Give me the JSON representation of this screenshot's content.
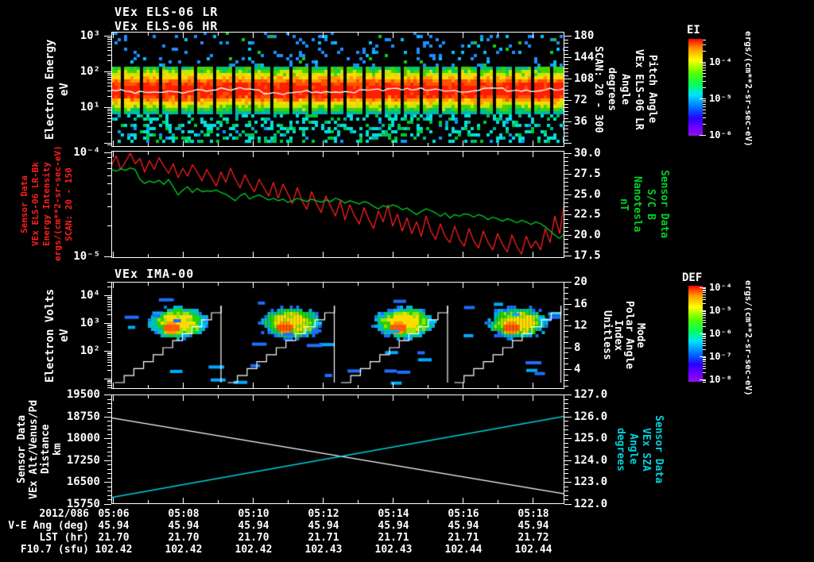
{
  "app": {
    "background": "#000000"
  },
  "colors": {
    "foreground": "#ffffff",
    "accent_red": "#ff1e1e",
    "accent_green": "#00d228",
    "accent_cyan": "#00d2dc",
    "rainbow_scale": [
      "#ff0000",
      "#ff9600",
      "#ffff00",
      "#50ff00",
      "#00e1ff",
      "#0064ff",
      "#7d00ff"
    ]
  },
  "titles": {
    "els_lr": "VEx ELS-06 LR",
    "els_hr": "VEx ELS-06 HR",
    "ima": "VEx IMA-00"
  },
  "time_axis": {
    "date": "2012/086",
    "tick_labels": [
      "05:06",
      "05:08",
      "05:10",
      "05:12",
      "05:14",
      "05:16",
      "05:18"
    ]
  },
  "chart_data": [
    {
      "name": "els_pitch_angle_spectrogram",
      "type": "heatmap",
      "title": "VEx ELS-06 LR / VEx ELS-06 HR",
      "left_axis": {
        "label_lines": [
          "Electron Energy",
          "eV"
        ],
        "scale": "log",
        "tick_labels": [
          "10³",
          "10²",
          "10¹"
        ]
      },
      "right_axis": {
        "label_lines": [
          "Pitch Angle",
          "VEx ELS-06 LR",
          "Angle",
          "degrees",
          "SCAN: 20 - 300"
        ],
        "tick_labels": [
          "180",
          "144",
          "108",
          "72",
          "36"
        ],
        "range": [
          0,
          180
        ]
      },
      "features": {
        "intense_band_energy_ev": [
          8,
          120
        ],
        "band_structure": "red-orange core with yellow then green edges",
        "overlay_line": "white pitch-angle trace wiggling near 72-90 deg",
        "data_gaps": "periodic narrow vertical black gaps through the band",
        "speckle_above": "sparse blue/cyan dots",
        "speckle_below": "dense cyan/green speckle"
      }
    },
    {
      "name": "els_bk_intensity_and_b_field",
      "type": "line",
      "left_axis": {
        "label_lines": [
          "Sensor Data",
          "VEx ELS-06 LR-Bk",
          "Energy Intensity",
          "ergs/(cm**2-sr-sec-eV)",
          "SCAN: 20 - 150"
        ],
        "scale": "log",
        "tick_labels": [
          "10⁻⁴",
          "10⁻⁵"
        ],
        "color": "#ff1e1e"
      },
      "right_axis": {
        "label_lines": [
          "Sensor Data",
          "S/C B",
          "Nanotesla",
          "nT"
        ],
        "tick_labels": [
          "30.0",
          "27.5",
          "25.0",
          "22.5",
          "20.0",
          "17.5"
        ],
        "color": "#00d228"
      },
      "series": [
        {
          "name": "ELS-06 LR-Bk Energy Intensity",
          "color": "#ff1e1e",
          "axis": "left",
          "unit": "1e-5 ergs/(cm**2-sr-sec-eV)",
          "values": [
            7.6,
            9.6,
            7.0,
            8.4,
            10.2,
            8.0,
            9.0,
            6.6,
            8.6,
            7.0,
            9.2,
            7.6,
            6.4,
            8.0,
            5.8,
            7.2,
            6.0,
            7.8,
            6.6,
            5.4,
            7.0,
            5.8,
            4.8,
            6.6,
            5.2,
            7.2,
            5.6,
            4.6,
            6.2,
            5.0,
            4.2,
            5.6,
            4.6,
            3.8,
            5.2,
            3.6,
            5.0,
            4.0,
            3.2,
            4.6,
            3.4,
            2.8,
            4.2,
            3.2,
            2.6,
            3.8,
            3.0,
            2.4,
            3.4,
            2.2,
            3.1,
            2.4,
            2.0,
            2.9,
            2.2,
            1.8,
            2.7,
            2.1,
            3.1,
            1.9,
            2.5,
            1.7,
            2.3,
            1.6,
            2.1,
            1.5,
            2.4,
            1.7,
            1.4,
            2.0,
            1.5,
            1.3,
            1.9,
            1.4,
            1.2,
            1.8,
            1.35,
            1.15,
            1.7,
            1.3,
            1.1,
            1.6,
            1.25,
            1.05,
            1.55,
            1.2,
            1.0,
            1.5,
            1.15,
            1.35,
            1.1,
            1.8,
            1.3,
            2.4,
            1.6,
            3.3
          ]
        },
        {
          "name": "S/C B",
          "color": "#00d228",
          "axis": "right",
          "unit": "nT",
          "values": [
            28.0,
            27.8,
            28.1,
            27.9,
            28.2,
            28.0,
            26.8,
            26.3,
            26.6,
            26.4,
            26.7,
            26.2,
            26.8,
            25.9,
            24.9,
            25.5,
            25.9,
            25.2,
            25.7,
            25.3,
            25.4,
            25.35,
            25.5,
            25.2,
            25.0,
            24.6,
            24.2,
            24.8,
            25.1,
            24.4,
            24.7,
            24.9,
            24.6,
            24.3,
            24.5,
            24.2,
            24.4,
            24.0,
            24.2,
            24.5,
            24.3,
            24.1,
            24.4,
            24.2,
            24.0,
            24.3,
            24.1,
            24.5,
            24.3,
            23.9,
            24.2,
            24.0,
            23.8,
            24.1,
            23.9,
            23.5,
            23.2,
            23.6,
            23.4,
            23.7,
            23.5,
            23.1,
            23.3,
            22.9,
            22.5,
            22.9,
            23.2,
            23.0,
            22.7,
            22.3,
            22.7,
            22.1,
            22.5,
            22.3,
            22.6,
            22.5,
            22.2,
            22.5,
            22.3,
            21.9,
            22.2,
            22.0,
            21.7,
            22.0,
            21.8,
            21.5,
            21.8,
            21.6,
            21.3,
            21.6,
            21.4,
            21.0,
            20.5,
            20.0,
            19.6,
            20.2
          ]
        }
      ]
    },
    {
      "name": "ima_ion_spectrogram",
      "type": "heatmap",
      "title": "VEx IMA-00",
      "left_axis": {
        "label_lines": [
          "Electron Volts",
          "eV"
        ],
        "scale": "log",
        "tick_labels": [
          "10⁴",
          "10³",
          "10²"
        ]
      },
      "right_axis": {
        "label_lines": [
          "Mode",
          "Polar Angle",
          "Index",
          "Unitless"
        ],
        "tick_labels": [
          "20",
          "16",
          "12",
          "8",
          "4"
        ]
      },
      "features": {
        "cycles": 4,
        "blob": "ion flux blob ~300-3000 eV each cycle: green-yellow body, orange core, cyan/blue fringe",
        "staircase": "white stepped energy-sweep line rising through each cycle then resetting",
        "dashes": "scattered blue horizontal dashes"
      }
    },
    {
      "name": "altitude_and_sza",
      "type": "line",
      "left_axis": {
        "label_lines": [
          "Sensor Data",
          "VEx Alt/Venus/Pd",
          "Distance",
          "km"
        ],
        "tick_labels": [
          "19500",
          "18750",
          "18000",
          "17250",
          "16500",
          "15750"
        ]
      },
      "right_axis": {
        "label_lines": [
          "Sensor Data",
          "VEx SZA",
          "Angle",
          "degrees"
        ],
        "tick_labels": [
          "127.0",
          "126.0",
          "125.0",
          "124.0",
          "123.0",
          "122.0"
        ],
        "color": "#00d2dc"
      },
      "series": [
        {
          "name": "VEx Alt/Venus/Pd Distance",
          "color": "#ffffff",
          "axis": "left",
          "unit": "km",
          "values": [
            18700,
            16100
          ]
        },
        {
          "name": "VEx SZA",
          "color": "#00d2dc",
          "axis": "right",
          "unit": "degrees",
          "values": [
            122.3,
            126.0
          ]
        }
      ]
    }
  ],
  "colorbars": [
    {
      "title": "EI",
      "tick_labels": [
        "10⁻⁴",
        "10⁻⁵",
        "10⁻⁶"
      ],
      "units": "ergs/(cm**2-sr-sec-eV)"
    },
    {
      "title": "DEF",
      "tick_labels": [
        "10⁻⁴",
        "10⁻⁵",
        "10⁻⁶",
        "10⁻⁷",
        "10⁻⁸"
      ],
      "units": "ergs/(cm**2-sr-sec-eV)"
    }
  ],
  "bottom_table": {
    "rows": [
      {
        "label": "2012/086",
        "values": [
          "05:06",
          "05:08",
          "05:10",
          "05:12",
          "05:14",
          "05:16",
          "05:18"
        ]
      },
      {
        "label": "V-E Ang (deg)",
        "values": [
          "45.94",
          "45.94",
          "45.94",
          "45.94",
          "45.94",
          "45.94",
          "45.94"
        ]
      },
      {
        "label": "LST (hr)",
        "values": [
          "21.70",
          "21.70",
          "21.70",
          "21.71",
          "21.71",
          "21.71",
          "21.72"
        ]
      },
      {
        "label": "F10.7 (sfu)",
        "values": [
          "102.42",
          "102.42",
          "102.42",
          "102.43",
          "102.43",
          "102.44",
          "102.44"
        ]
      }
    ]
  }
}
